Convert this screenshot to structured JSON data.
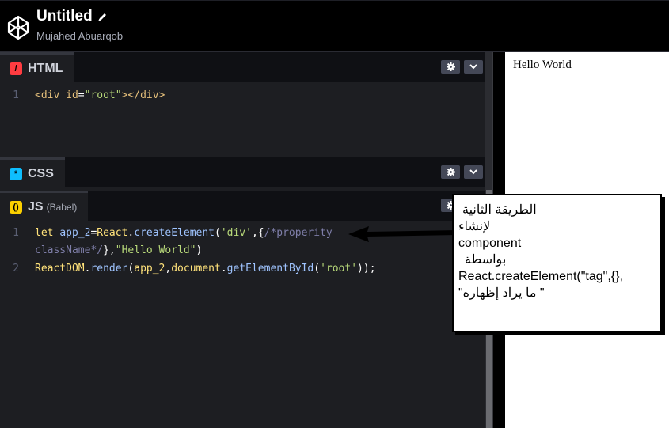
{
  "header": {
    "title": "Untitled",
    "author": "Mujahed Abuarqob"
  },
  "panes": {
    "html": {
      "label": "HTML",
      "icon": "html-slash-icon",
      "accent": "#ff3c41",
      "lines": [
        {
          "num": "1",
          "code": "<div id=\"root\"></div>"
        }
      ]
    },
    "css": {
      "label": "CSS",
      "icon": "css-asterisk-icon",
      "accent": "#0ebeff"
    },
    "js": {
      "label": "JS",
      "sublabel": "(Babel)",
      "icon": "js-parens-icon",
      "accent": "#fcd000",
      "lines": [
        {
          "num": "1",
          "code": "let app_2=React.createElement('div',{/*properity"
        },
        {
          "num": "",
          "code": "className*/},\"Hello World\")"
        },
        {
          "num": "2",
          "code": "ReactDOM.render(app_2,document.getElementById('root'));"
        }
      ]
    }
  },
  "preview": {
    "text": "Hello World"
  },
  "annotation": {
    "line1": "الطريقة الثانية",
    "line2": "لإنشاء",
    "line3": "component",
    "line4": "بواسطة",
    "line5": "React.createElement(\"tag\",{},",
    "line6": "\" ما يراد إظهاره\""
  }
}
